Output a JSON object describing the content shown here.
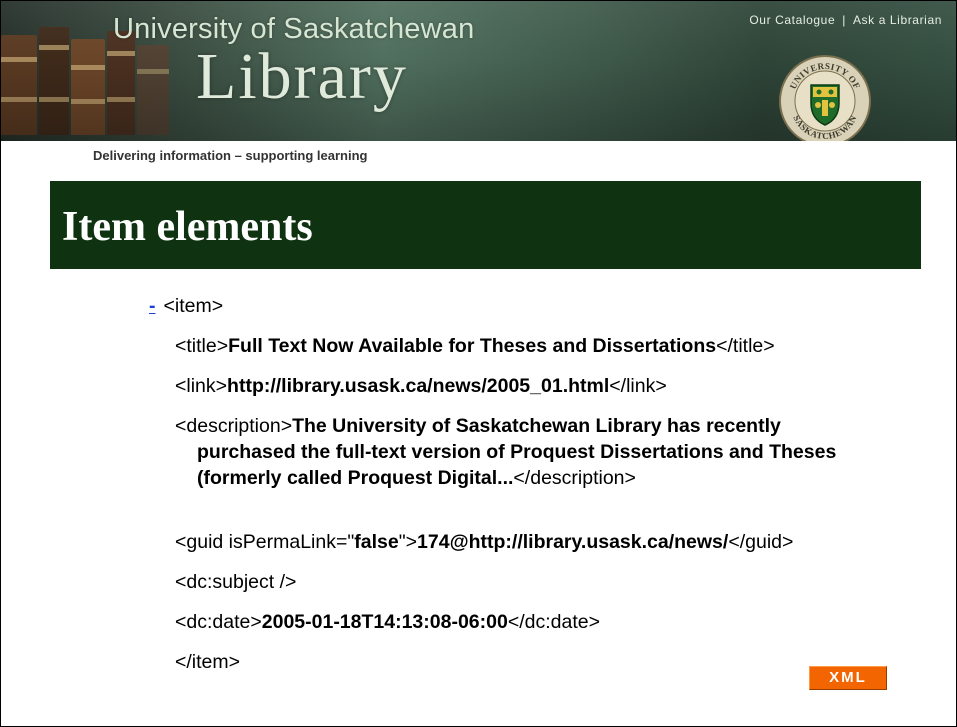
{
  "header": {
    "university": "University of Saskatchewan",
    "library": "Library",
    "links": [
      "Our Catalogue",
      "Ask a Librarian"
    ],
    "link_separator": "|",
    "tagline": "Delivering information – supporting learning",
    "seal_text": "UNIVERSITY OF SASKATCHEWAN"
  },
  "title": "Item elements",
  "xml_tree": {
    "collapse_marker": "-",
    "item_open": "<item>",
    "title_open": "<title>",
    "title_value": "Full Text Now Available for Theses and Dissertations",
    "title_close": "</title>",
    "link_open": "<link>",
    "link_value": "http://library.usask.ca/news/2005_01.html",
    "link_close": "</link>",
    "description_open": "<description>",
    "description_line1": "The University of Saskatchewan Library has recently",
    "description_line2": "purchased the full-text version of Proquest Dissertations and Theses",
    "description_line3": "(formerly called Proquest Digital...",
    "description_close": "</description>",
    "guid_open": "<guid isPermaLink=\"",
    "guid_attr_value": "false",
    "guid_open_end": "\">",
    "guid_value": "174@http://library.usask.ca/news/",
    "guid_close": "</guid>",
    "subject": "<dc:subject />",
    "date_open": "<dc:date>",
    "date_value": "2005-01-18T14:13:08-06:00",
    "date_close": "</dc:date>",
    "item_close": "</item>"
  },
  "badge": {
    "label": "XML"
  },
  "colors": {
    "title_bar": "#0f3311",
    "collapse_marker": "#1b3fd8",
    "xml_badge": "#f26500"
  }
}
